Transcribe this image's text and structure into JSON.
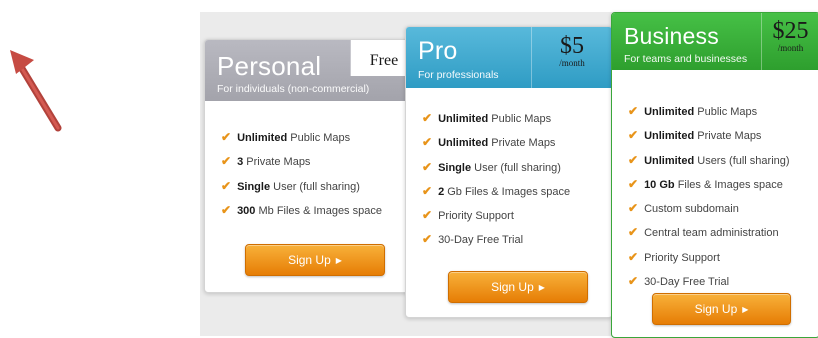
{
  "plans": [
    {
      "name": "Personal",
      "subtitle": "For individuals (non-commercial)",
      "price": "Free",
      "features": [
        {
          "bold": "Unlimited",
          "text": " Public Maps"
        },
        {
          "bold": "3",
          "text": " Private Maps"
        },
        {
          "bold": "Single",
          "text": " User (full sharing)"
        },
        {
          "bold": "300",
          "text": " Mb Files & Images space"
        }
      ],
      "button": "Sign Up"
    },
    {
      "name": "Pro",
      "subtitle": "For professionals",
      "price": "$5",
      "per": "/month",
      "features": [
        {
          "bold": "Unlimited",
          "text": " Public Maps"
        },
        {
          "bold": "Unlimited",
          "text": " Private Maps"
        },
        {
          "bold": "Single",
          "text": " User (full sharing)"
        },
        {
          "bold": "2",
          "text": " Gb Files & Images space"
        },
        {
          "bold": "",
          "text": "Priority Support"
        },
        {
          "bold": "",
          "text": "30-Day Free Trial"
        }
      ],
      "button": "Sign Up"
    },
    {
      "name": "Business",
      "subtitle": "For teams and businesses",
      "price": "$25",
      "per": "/month",
      "features": [
        {
          "bold": "Unlimited",
          "text": " Public Maps"
        },
        {
          "bold": "Unlimited",
          "text": " Private Maps"
        },
        {
          "bold": "Unlimited",
          "text": " Users (full sharing)"
        },
        {
          "bold": "10 Gb",
          "text": " Files & Images space"
        },
        {
          "bold": "",
          "text": "Custom subdomain"
        },
        {
          "bold": "",
          "text": "Central team administration"
        },
        {
          "bold": "",
          "text": "Priority Support"
        },
        {
          "bold": "",
          "text": "30-Day Free Trial"
        }
      ],
      "button": "Sign Up"
    }
  ],
  "icons": {
    "check": "check-icon",
    "button_arrow": "triangle-right-icon",
    "annotation": "red-arrow"
  },
  "colors": {
    "personal": "#a9a9b1",
    "pro": "#3ea8cf",
    "business": "#35ad35",
    "button": "#f09a1e",
    "annotation_arrow": "#c0473f"
  }
}
